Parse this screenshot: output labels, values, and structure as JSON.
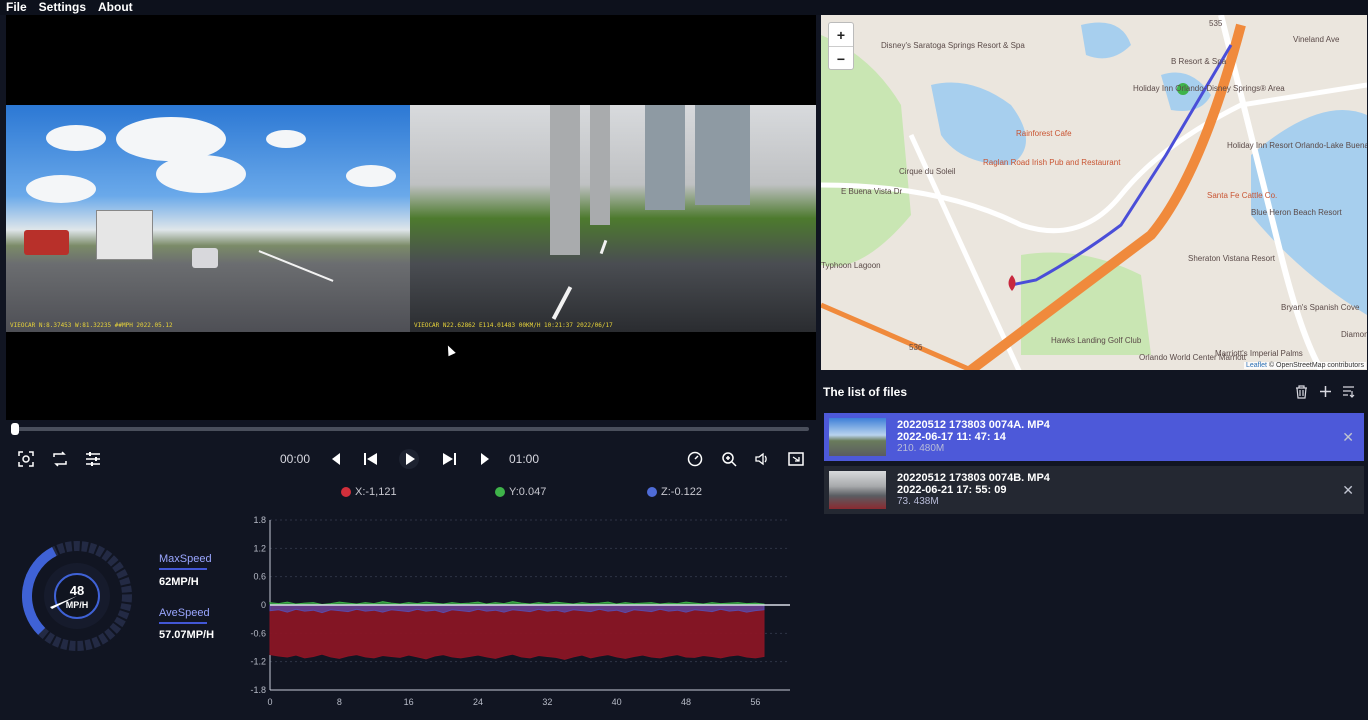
{
  "menu": {
    "items": [
      "File",
      "Settings",
      "About"
    ]
  },
  "camera": {
    "left_overlay": "VIEOCAR    N:8.37453 W:81.32235 ##MPH  2022.05.12",
    "right_overlay": "VIEOCAR   N22.62862  E114.01483 00KM/H 10:21:37 2022/06/17"
  },
  "player": {
    "current_time": "00:00",
    "total_time": "01:00",
    "progress": 0.0
  },
  "legend": {
    "x_label": "X:-1,121",
    "y_label": "Y:0.047",
    "z_label": "Z:-0.122",
    "x_color": "#d22f3b",
    "y_color": "#3fb34a",
    "z_color": "#4f6cd8"
  },
  "speed": {
    "current": "48",
    "unit": "MP/H",
    "max_label": "MaxSpeed",
    "max_value": "62MP/H",
    "ave_label": "AveSpeed",
    "ave_value": "57.07MP/H",
    "fraction": 0.4
  },
  "chart_data": {
    "type": "area",
    "x_ticks": [
      0,
      8,
      16,
      24,
      32,
      40,
      48,
      56
    ],
    "y_ticks": [
      1.8,
      1.2,
      0.6,
      0,
      -0.6,
      -1.2,
      -1.8
    ],
    "xlim": [
      0,
      60
    ],
    "ylim": [
      -1.8,
      1.8
    ],
    "grid": true,
    "series": [
      {
        "name": "X",
        "color": "#8a1525",
        "values": [
          -1.05,
          -1.08,
          -1.1,
          -1.06,
          -1.12,
          -1.09,
          -1.04,
          -1.1,
          -1.13,
          -1.08,
          -1.05,
          -1.1,
          -1.12,
          -1.07,
          -1.09,
          -1.11,
          -1.06,
          -1.1,
          -1.14,
          -1.08,
          -1.05,
          -1.1,
          -1.12,
          -1.09,
          -1.06,
          -1.1,
          -1.13,
          -1.08,
          -1.04,
          -1.1,
          -1.12,
          -1.07,
          -1.09,
          -1.11,
          -1.15,
          -1.1,
          -1.06,
          -1.12,
          -1.08,
          -1.05,
          -1.1,
          -1.13,
          -1.09,
          -1.06,
          -1.1,
          -1.12,
          -1.08,
          -1.05,
          -1.1,
          -1.11,
          -1.07,
          -1.09,
          -1.12,
          -1.08,
          -1.06,
          -1.1,
          -1.12,
          -1.09
        ]
      },
      {
        "name": "Y",
        "color": "#3fb34a",
        "values": [
          0.05,
          0.03,
          0.06,
          0.02,
          0.04,
          0.05,
          0.01,
          0.03,
          0.06,
          0.04,
          0.02,
          0.05,
          0.03,
          0.07,
          0.04,
          0.02,
          0.05,
          0.03,
          0.06,
          0.04,
          0.02,
          0.05,
          0.03,
          0.04,
          0.06,
          0.02,
          0.05,
          0.03,
          0.07,
          0.04,
          0.02,
          0.05,
          0.03,
          0.06,
          0.04,
          0.02,
          0.05,
          0.03,
          0.04,
          0.06,
          0.02,
          0.05,
          0.03,
          0.04,
          0.05,
          0.02,
          0.04,
          0.03,
          0.06,
          0.04,
          0.02,
          0.05,
          0.03,
          0.04,
          0.05,
          0.03,
          0.04,
          0.02
        ]
      },
      {
        "name": "Z",
        "color": "#5a4aa8",
        "values": [
          -0.12,
          -0.1,
          -0.15,
          -0.09,
          -0.13,
          -0.11,
          -0.16,
          -0.1,
          -0.12,
          -0.14,
          -0.09,
          -0.13,
          -0.11,
          -0.15,
          -0.1,
          -0.12,
          -0.14,
          -0.09,
          -0.13,
          -0.11,
          -0.16,
          -0.1,
          -0.12,
          -0.14,
          -0.09,
          -0.13,
          -0.11,
          -0.15,
          -0.1,
          -0.12,
          -0.14,
          -0.09,
          -0.13,
          -0.11,
          -0.15,
          -0.1,
          -0.12,
          -0.14,
          -0.09,
          -0.13,
          -0.11,
          -0.16,
          -0.1,
          -0.12,
          -0.14,
          -0.09,
          -0.13,
          -0.11,
          -0.15,
          -0.1,
          -0.12,
          -0.14,
          -0.09,
          -0.13,
          -0.11,
          -0.15,
          -0.12,
          -0.1
        ]
      }
    ]
  },
  "map": {
    "zoom_in": "+",
    "zoom_out": "−",
    "labels": [
      "Disney's Saratoga Springs Resort & Spa",
      "B Resort & Spa",
      "Holiday Inn Orlando-Disney Springs® Area",
      "Rainforest Cafe",
      "Raglan Road Irish Pub and Restaurant",
      "Cirque du Soleil",
      "E Buena Vista Dr",
      "Holiday Inn Resort Orlando-Lake Buena Vista",
      "Santa Fe Cattle Co.",
      "Blue Heron Beach Resort",
      "Sheraton Vistana Resort",
      "Typhoon Lagoon",
      "Bryan's Spanish Cove",
      "Hawks Landing Golf Club",
      "Orlando World Center Marriott",
      "Marriott's Imperial Palms",
      "Diamond",
      "535",
      "536",
      "Vineland Ave"
    ],
    "attribution_leaflet": "Leaflet",
    "attribution_osm": "© OpenStreetMap contributors"
  },
  "files": {
    "title": "The list of files",
    "items": [
      {
        "name": "20220512  173803  0074A. MP4",
        "date": "2022-06-17  11: 47: 14",
        "size": "210. 480M",
        "active": true
      },
      {
        "name": "20220512  173803  0074B. MP4",
        "date": "2022-06-21  17: 55: 09",
        "size": "73. 438M",
        "active": false
      }
    ]
  },
  "colors": {
    "accent": "#4d59d9",
    "route": "#4a4ed8",
    "highway": "#f08a3c"
  }
}
